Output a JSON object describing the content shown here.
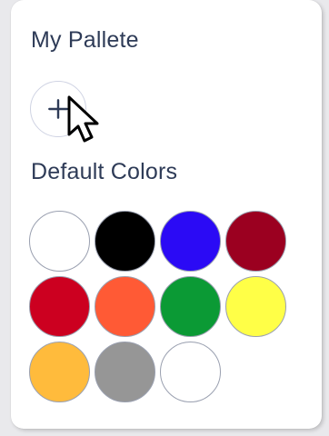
{
  "my_pallete": {
    "title": "My Pallete",
    "add_icon": "plus-icon"
  },
  "default_colors": {
    "title": "Default Colors",
    "swatches": [
      {
        "color": "#ffffff"
      },
      {
        "color": "#000000"
      },
      {
        "color": "#2b0af5"
      },
      {
        "color": "#9b0020"
      },
      {
        "color": "#cc0020"
      },
      {
        "color": "#ff5a35"
      },
      {
        "color": "#0b9a35"
      },
      {
        "color": "#ffff47"
      },
      {
        "color": "#ffbb3c"
      },
      {
        "color": "#969696"
      },
      {
        "color": "#ffffff"
      }
    ]
  },
  "cursor": {
    "icon": "arrow-cursor-icon"
  }
}
